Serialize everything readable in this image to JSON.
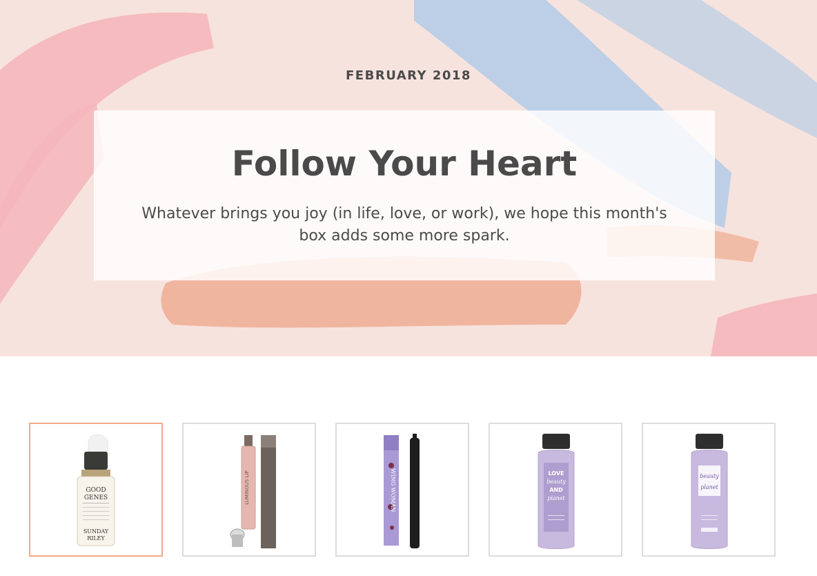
{
  "hero": {
    "month": "FEBRUARY 2018",
    "title": "Follow Your Heart",
    "description": "Whatever brings you joy (in life, love, or work), we hope this month's box adds some more spark.",
    "background_color": "#f7e3de",
    "stroke_colors": [
      "#f4b6bb",
      "#b8cde6",
      "#f0b59e"
    ]
  },
  "products": {
    "selected_index": 0,
    "selected_border_color": "#f3a98a",
    "items": [
      {
        "icon": "serum-bottle-icon",
        "label_lines": [
          "GOOD",
          "GENES"
        ],
        "brand_lines": [
          "SUNDAY",
          "RILEY"
        ]
      },
      {
        "icon": "lip-gloss-icon",
        "label_lines": [
          "LUMINOUS LIP"
        ]
      },
      {
        "icon": "eyeliner-icon",
        "label_lines": [
          "WING WOMAN"
        ]
      },
      {
        "icon": "shampoo-bottle-icon",
        "label_lines": [
          "LOVE",
          "beauty",
          "AND",
          "planet"
        ]
      },
      {
        "icon": "conditioner-bottle-icon",
        "label_lines": [
          "beauty",
          "planet"
        ]
      }
    ]
  }
}
